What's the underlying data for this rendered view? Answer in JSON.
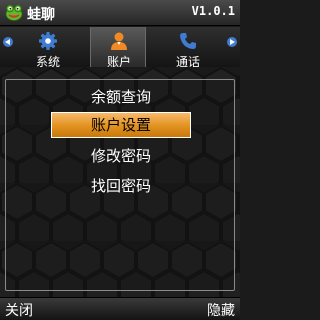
{
  "app": {
    "name": "蛙聊",
    "version": "V1.0.1"
  },
  "tabs": [
    {
      "label": "系统",
      "icon": "gear-icon",
      "active": false
    },
    {
      "label": "账户",
      "icon": "user-icon",
      "active": true
    },
    {
      "label": "通话",
      "icon": "phone-icon",
      "active": false
    }
  ],
  "menu": {
    "items": [
      {
        "label": "余额查询",
        "selected": false
      },
      {
        "label": "账户设置",
        "selected": true
      },
      {
        "label": "修改密码",
        "selected": false
      },
      {
        "label": "找回密码",
        "selected": false
      }
    ]
  },
  "softkeys": {
    "left": "关闭",
    "right": "隐藏"
  },
  "colors": {
    "accent": "#e1921f",
    "tab_icon_blue": "#3f7bd1",
    "user_icon_orange": "#f08a24",
    "logo_green": "#5fb82c"
  }
}
